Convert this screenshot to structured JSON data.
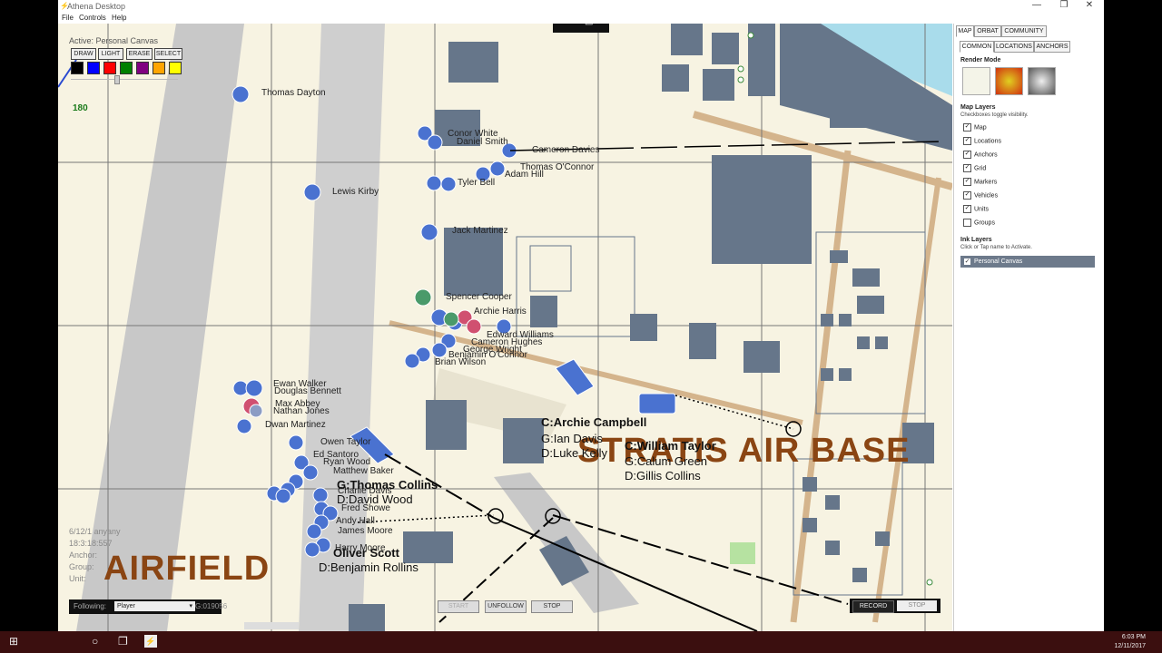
{
  "window": {
    "title": "Athena Desktop",
    "controls": {
      "minimize": "—",
      "maximize": "❐",
      "close": "✕"
    }
  },
  "menu": [
    "File",
    "Controls",
    "Help"
  ],
  "ink_toolbar": {
    "caption": "Active: Personal Canvas",
    "buttons": [
      "DRAW",
      "LIGHT",
      "ERASE",
      "SELECT"
    ],
    "colors": [
      "#000000",
      "#0000ff",
      "#ff0000",
      "#008000",
      "#800080",
      "#ffa500",
      "#ffff00"
    ]
  },
  "map": {
    "grid_number": "180",
    "unit_labels": [
      "Thomas Dayton",
      "Conor White",
      "Daniel Smith",
      "Cameron Davies",
      "Thomas O'Connor",
      "Adam Hill",
      "Tyler Bell",
      "Lewis Kirby",
      "Jack Martinez",
      "Spencer Cooper",
      "Archie Harris",
      "Edward Williams",
      "Cameron Hughes",
      "George Wright",
      "Benjamin O'Connor",
      "Brian Wilson",
      "Ewan Walker",
      "Douglas Bennett",
      "Max Abbey",
      "Nathan Jones",
      "Dwan Martinez",
      "Owen Taylor",
      "Ed Santoro",
      "Ryan Wood",
      "Matthew Baker",
      "Charlie Davis",
      "Fred Showe",
      "Andy Hall",
      "James Moore",
      "Harry Moore"
    ],
    "group_labels": [
      {
        "lines": [
          "C:Archie Campbell",
          "G:Ian Davis",
          "D:Luke Kelly"
        ]
      },
      {
        "lines": [
          "C:William Taylor",
          "G:Calum Green",
          "D:Gillis Collins"
        ]
      },
      {
        "lines": [
          "G:Thomas Collins",
          "D:David Wood"
        ]
      },
      {
        "lines": [
          "Oliver Scott",
          "D:Benjamin Rollins"
        ]
      }
    ],
    "place_names": [
      "STRATIS AIR BASE",
      "AIRFIELD"
    ],
    "colors": {
      "land": "#f7f3e2",
      "building": "#66768a",
      "runway": "#c8c8c8",
      "water": "#a9dceb",
      "road": "#d4b48c",
      "unit": "#4a72d0"
    }
  },
  "status": {
    "date": "6/12/1 anyany",
    "time": "18:3:18:557",
    "anchor": "Anchor:",
    "group": "Group:",
    "unit": "Unit:"
  },
  "follow": {
    "label": "Following:",
    "value": "Player",
    "id": "G:019056"
  },
  "playback": {
    "start": "START",
    "unfollow": "UNFOLLOW",
    "stop": "STOP"
  },
  "record": {
    "record": "RECORD",
    "stop": "STOP"
  },
  "panel": {
    "tabs": [
      "MAP",
      "ORBAT",
      "COMMUNITY"
    ],
    "subtabs": [
      "COMMON",
      "LOCATIONS",
      "ANCHORS"
    ],
    "render_mode_title": "Render Mode",
    "map_layers_title": "Map Layers",
    "map_layers_note": "Checkboxes toggle visibility.",
    "layers": [
      {
        "label": "Map",
        "checked": true
      },
      {
        "label": "Locations",
        "checked": true
      },
      {
        "label": "Anchors",
        "checked": true
      },
      {
        "label": "Grid",
        "checked": true
      },
      {
        "label": "Markers",
        "checked": true
      },
      {
        "label": "Vehicles",
        "checked": true
      },
      {
        "label": "Units",
        "checked": true
      },
      {
        "label": "Groups",
        "checked": false
      }
    ],
    "ink_layers_title": "Ink Layers",
    "ink_layers_note": "Click or Tap name to Activate.",
    "ink_layer": "Personal Canvas"
  },
  "taskbar": {
    "time": "6:03 PM",
    "date": "12/11/2017"
  }
}
